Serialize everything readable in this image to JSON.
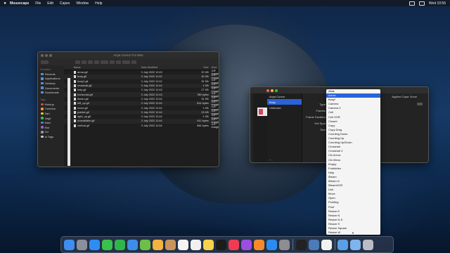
{
  "menubar": {
    "app": "Mousecape",
    "items": [
      "File",
      "Edit",
      "Capes",
      "Window",
      "Help"
    ],
    "clock": "Wed 10:56"
  },
  "finder": {
    "title": "Anya Cursor For Mac",
    "columns": [
      "Name",
      "Date Modified",
      "Size",
      "Kind"
    ],
    "sidebar": {
      "favorites_header": "Favorites",
      "favorites": [
        "Recents",
        "Applications",
        "Desktop",
        "Documents",
        "Downloads"
      ],
      "tags_header": "Tags",
      "tags": [
        {
          "label": "Kimkup",
          "color": "#e0464e"
        },
        {
          "label": "Tumelou",
          "color": "#f0a030"
        },
        {
          "label": "Sari",
          "color": "#e8d23a"
        },
        {
          "label": "Vegit",
          "color": "#3ec04b"
        },
        {
          "label": "Mavi",
          "color": "#3a8ee6"
        },
        {
          "label": "Mor",
          "color": "#a45ad6"
        },
        {
          "label": "Gri",
          "color": "#9a9a9a"
        },
        {
          "label": "Is Tags",
          "color": "#cccccc"
        }
      ]
    },
    "files": [
      {
        "name": "arrow.gif",
        "date": "3 July 2022 12:43",
        "size": "22 KB",
        "kind": "GIF image"
      },
      {
        "name": "busy.gif",
        "date": "3 July 2022 12:42",
        "size": "30 KB",
        "kind": "GIF image"
      },
      {
        "name": "busy2.gif",
        "date": "3 July 2022 12:42",
        "size": "32 KB",
        "kind": "GIF image"
      },
      {
        "name": "crosshair.gif",
        "date": "3 July 2022 12:44",
        "size": "1 KB",
        "kind": "GIF image"
      },
      {
        "name": "help.gif",
        "date": "3 July 2022 12:43",
        "size": "27 KB",
        "kind": "GIF image"
      },
      {
        "name": "horizontal.gif",
        "date": "3 July 2022 12:43",
        "size": "785 bytes",
        "kind": "GIF image"
      },
      {
        "name": "ibeam.gif",
        "date": "3 July 2022 12:44",
        "size": "31 KB",
        "kind": "GIF image"
      },
      {
        "name": "left_up.gif",
        "date": "3 July 2022 12:44",
        "size": "814 bytes",
        "kind": "GIF image"
      },
      {
        "name": "move.gif",
        "date": "3 July 2022 12:44",
        "size": "1 KB",
        "kind": "GIF image"
      },
      {
        "name": "pointer.gif",
        "date": "3 July 2022 12:44",
        "size": "23 KB",
        "kind": "GIF image"
      },
      {
        "name": "right_up.gif",
        "date": "3 July 2022 12:44",
        "size": "1 KB",
        "kind": "GIF image"
      },
      {
        "name": "unavailable.gif",
        "date": "3 July 2022 12:44",
        "size": "912 bytes",
        "kind": "GIF image"
      },
      {
        "name": "vertical.gif",
        "date": "3 July 2022 12:44",
        "size": "684 bytes",
        "kind": "GIF image"
      }
    ]
  },
  "mousecape": {
    "list_header": "Anya Cursor",
    "list_items": [
      "Busy",
      "Unknown"
    ],
    "selected_index": 0,
    "applied_label": "Applied Cape: None",
    "field_labels": [
      "Type",
      "Frames",
      "Frame Duration",
      "Hot Spot",
      "Size"
    ],
    "footer": "+ -"
  },
  "dropdown": {
    "selected": "Arrow",
    "items": [
      "Alias",
      "Arrow",
      "Busy*",
      "Camera",
      "Camera 2",
      "Cell",
      "Cell XOR",
      "Closed",
      "Copy",
      "Copy Drag",
      "Counting Down",
      "Counting Up",
      "Counting Up/Down",
      "Crosshair",
      "Crosshair 2",
      "Ctx Arrow",
      "Ctx Menu",
      "Empty",
      "Forbidden",
      "Help",
      "IBeam",
      "IBeam H.",
      "IBeamXOR",
      "Link",
      "Move",
      "Open",
      "Pointing",
      "Poof",
      "Resize E",
      "Resize N",
      "Resize N-S",
      "Resize S",
      "Resize Square",
      "Resize W"
    ],
    "more_arrow": "▼"
  },
  "dock": {
    "icons": [
      {
        "name": "finder-icon",
        "color": "#3d8ef0"
      },
      {
        "name": "launchpad-icon",
        "color": "#8a8f9a"
      },
      {
        "name": "safari-icon",
        "color": "#2e8df5"
      },
      {
        "name": "messages-icon",
        "color": "#39c24b"
      },
      {
        "name": "facetime-icon",
        "color": "#2fb64a"
      },
      {
        "name": "mail-icon",
        "color": "#3f8de8"
      },
      {
        "name": "maps-icon",
        "color": "#6cc04a"
      },
      {
        "name": "photos-icon",
        "color": "#f2b340"
      },
      {
        "name": "contacts-icon",
        "color": "#c9955c"
      },
      {
        "name": "calendar-icon",
        "color": "#f4f4f4"
      },
      {
        "name": "reminders-icon",
        "color": "#f0f0f0"
      },
      {
        "name": "notes-icon",
        "color": "#f6d34a"
      },
      {
        "name": "tv-icon",
        "color": "#1c1c1c"
      },
      {
        "name": "music-icon",
        "color": "#f03c52"
      },
      {
        "name": "podcasts-icon",
        "color": "#9b4fe0"
      },
      {
        "name": "books-icon",
        "color": "#f58a2a"
      },
      {
        "name": "app-store-icon",
        "color": "#2a8cf0"
      },
      {
        "name": "system-preferences-icon",
        "color": "#8d8d92"
      },
      {
        "name": "terminal-icon",
        "color": "#222222"
      },
      {
        "name": "preview-icon",
        "color": "#4d7ab8"
      },
      {
        "name": "mousecape-icon",
        "color": "#f2f2f2"
      },
      {
        "name": "downloads-folder-icon",
        "color": "#5aa0e6"
      },
      {
        "name": "documents-folder-icon",
        "color": "#7fb4ec"
      },
      {
        "name": "trash-icon",
        "color": "#b8bcc4"
      }
    ]
  }
}
